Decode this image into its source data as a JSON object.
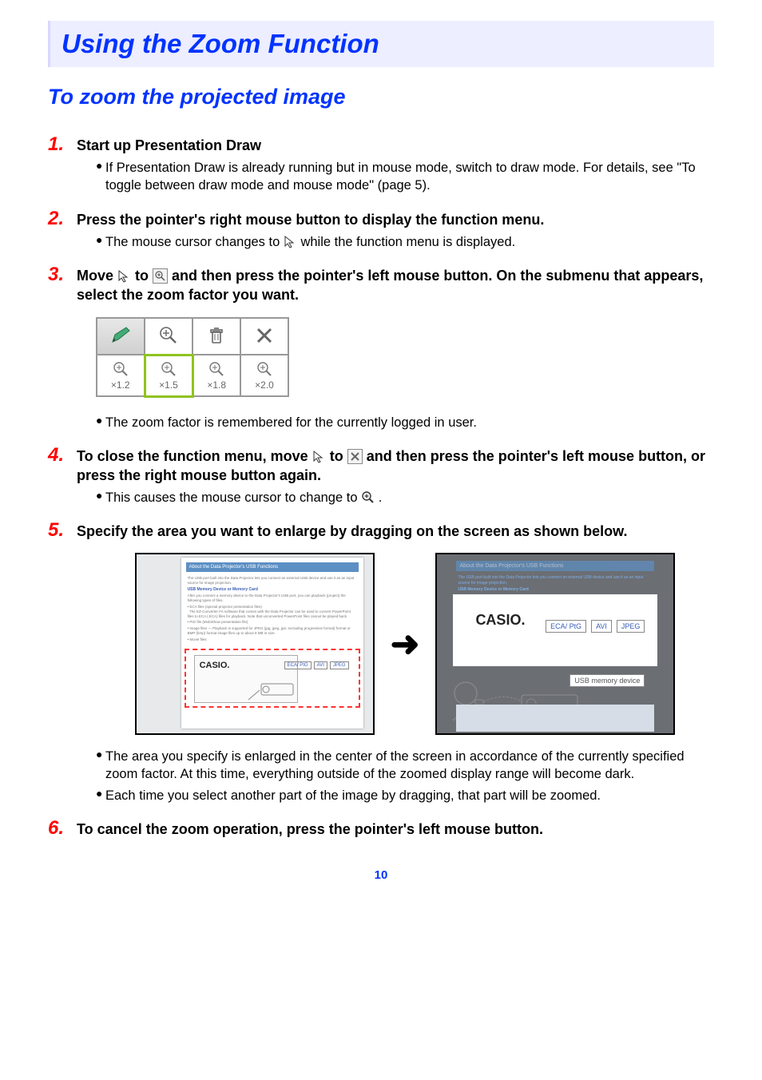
{
  "mainHeading": "Using the Zoom Function",
  "subHeading": "To zoom the projected image",
  "steps": {
    "s1": {
      "num": "1.",
      "title": "Start up Presentation Draw",
      "bullets": [
        "If Presentation Draw is already running but in mouse mode, switch to draw mode. For details, see \"To toggle between draw mode and mouse mode\" (page 5)."
      ]
    },
    "s2": {
      "num": "2.",
      "title": "Press the pointer's right mouse button to display the function menu.",
      "bullets": [
        "The mouse cursor changes to        while the function menu is displayed."
      ],
      "bulletA": "The mouse cursor changes to ",
      "bulletB": " while the function menu is displayed."
    },
    "s3": {
      "num": "3.",
      "titleA": "Move ",
      "titleB": " to ",
      "titleC": " and then press the pointer's left mouse button. On the submenu that appears, select the zoom factor you want.",
      "bulletAfter": "The zoom factor is remembered for the currently logged in user."
    },
    "s4": {
      "num": "4.",
      "titleA": "To close the function menu, move ",
      "titleB": " to ",
      "titleC": " and then press the pointer's left mouse button, or press the right mouse button again.",
      "bulletA": "This causes the mouse cursor to change to ",
      "bulletB": "."
    },
    "s5": {
      "num": "5.",
      "title": "Specify the area you want to enlarge by dragging on the screen as shown below.",
      "bullets": [
        "The area you specify is enlarged in the center of the screen in accordance of the currently specified zoom factor. At this time, everything outside of the zoomed display range will become dark.",
        "Each time you select another part of the image by dragging, that part will be zoomed."
      ]
    },
    "s6": {
      "num": "6.",
      "title": "To cancel the zoom operation, press the pointer's left mouse button."
    }
  },
  "zoomMenu": {
    "factors": [
      "×1.2",
      "×1.5",
      "×1.8",
      "×2.0"
    ]
  },
  "mockDoc": {
    "title": "About the Data Projector's USB Functions",
    "sectionA": "USB Memory Device or Memory Card",
    "casio": "CASIO.",
    "chips": [
      "ECA/ PtG",
      "AVI",
      "JPEG"
    ],
    "usbLabel": "USB memory device"
  },
  "pageNumber": "10"
}
